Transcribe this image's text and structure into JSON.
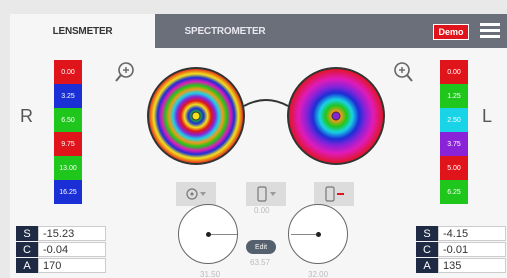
{
  "tabs": [
    {
      "label": "LENSMETER",
      "active": true
    },
    {
      "label": "SPECTROMETER",
      "active": false
    }
  ],
  "demo_badge": "Demo",
  "right_side": {
    "letter": "R",
    "scale": [
      {
        "value": "0.00",
        "color": "#e0141b"
      },
      {
        "value": "3.25",
        "color": "#1a2fd6"
      },
      {
        "value": "6.50",
        "color": "#1fc61b"
      },
      {
        "value": "9.75",
        "color": "#e0141b"
      },
      {
        "value": "13.00",
        "color": "#1fc61b"
      },
      {
        "value": "16.25",
        "color": "#1a2fd6"
      }
    ],
    "readout": [
      {
        "label": "S",
        "value": "-15.23"
      },
      {
        "label": "C",
        "value": "-0.04"
      },
      {
        "label": "A",
        "value": "170"
      }
    ]
  },
  "left_side": {
    "letter": "L",
    "scale": [
      {
        "value": "0.00",
        "color": "#e0141b"
      },
      {
        "value": "1.25",
        "color": "#1fc61b"
      },
      {
        "value": "2.50",
        "color": "#19d3e6"
      },
      {
        "value": "3.75",
        "color": "#8a22d8"
      },
      {
        "value": "5.00",
        "color": "#e0141b"
      },
      {
        "value": "6.25",
        "color": "#1fc61b"
      }
    ],
    "readout": [
      {
        "label": "S",
        "value": "-4.15"
      },
      {
        "label": "C",
        "value": "-0.01"
      },
      {
        "label": "A",
        "value": "135"
      }
    ]
  },
  "icons": {
    "zoom_in": "zoom-in-icon",
    "target": "target-icon",
    "phone": "phone-icon",
    "phone_remove": "phone-remove-icon"
  },
  "center_values": {
    "top": "0.00",
    "middle": "63.57",
    "left": "31.50",
    "right": "32.00"
  },
  "edit_label": "Edit"
}
